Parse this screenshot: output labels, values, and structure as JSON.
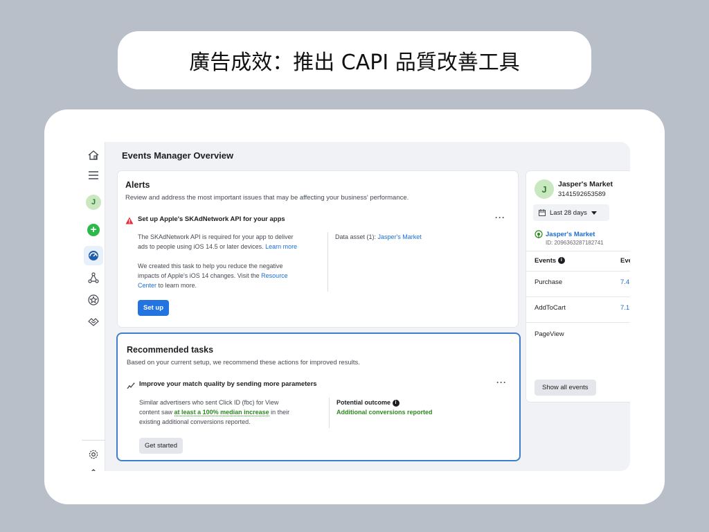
{
  "slide_title": "廣告成效：推出 CAPI 品質改善工具",
  "app": {
    "page_title": "Events Manager Overview",
    "rail": {
      "avatar_letter": "J"
    },
    "alerts": {
      "heading": "Alerts",
      "subtitle": "Review and address the most important issues that may be affecting your business' performance.",
      "item_title": "Set up Apple's SKAdNetwork API for your apps",
      "para1_line1": "The SKAdNetwork API is required for your app to deliver",
      "para1_line2_prefix": "ads to people using iOS 14.5 or later devices.",
      "learn_more": "Learn more",
      "para2_line1": "We created this task to help you reduce the negative",
      "para2_line2_prefix": "impacts of Apple's iOS 14 changes. Visit the",
      "resource_link_1": "Resource",
      "resource_link_2": "Center",
      "para2_line3_suffix": "to learn more.",
      "data_asset_label": "Data asset (1):",
      "data_asset_value": "Jasper's Market",
      "setup_button": "Set up",
      "more": "···"
    },
    "tasks": {
      "heading": "Recommended tasks",
      "subtitle": "Based on your current setup, we recommend these actions for improved results.",
      "item_title": "Improve your match quality by sending more parameters",
      "line1": "Similar advertisers who sent Click ID (fbc) for View",
      "line2_prefix": "content saw",
      "line2_highlight": "at least a 100% median increase",
      "line2_suffix": "in their",
      "line3": "existing additional conversions reported.",
      "outcome_label": "Potential outcome",
      "outcome_value": "Additional conversions reported",
      "get_started_button": "Get started",
      "more": "···"
    },
    "side_panel": {
      "avatar_letter": "J",
      "name": "Jasper's Market",
      "id": "3141592653589",
      "date_range": "Last 28 days",
      "asset_name": "Jasper's Market",
      "asset_id": "ID: 2096363287182741",
      "col_events": "Events",
      "col_events2": "Eve",
      "rows": [
        {
          "event": "Purchase",
          "value": "7.4"
        },
        {
          "event": "AddToCart",
          "value": "7.1"
        },
        {
          "event": "PageView",
          "value": ""
        }
      ],
      "show_all": "Show all events"
    }
  }
}
